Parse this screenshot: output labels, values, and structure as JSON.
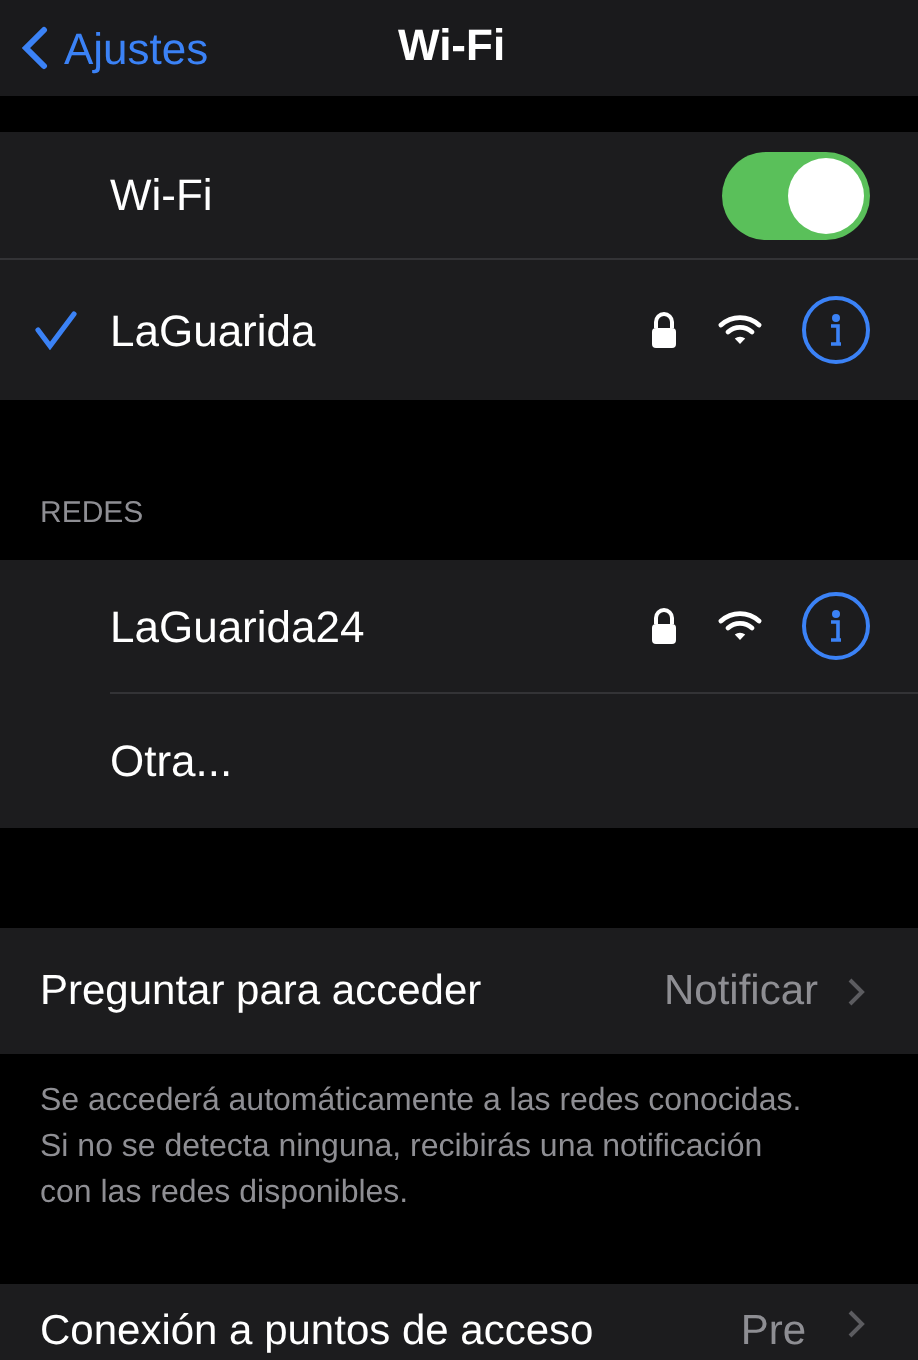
{
  "nav": {
    "back": "Ajustes",
    "title": "Wi-Fi"
  },
  "wifi": {
    "label": "Wi-Fi",
    "on": true,
    "current": {
      "name": "LaGuarida",
      "selected": true,
      "locked": true
    }
  },
  "networks": {
    "header": "REDES",
    "items": [
      {
        "kind": "network",
        "name": "LaGuarida24",
        "locked": true
      },
      {
        "kind": "other",
        "name": "Otra..."
      }
    ]
  },
  "ask": {
    "label": "Preguntar para acceder",
    "value": "Notificar",
    "footer": "Se accederá automáticamente a las redes conocidas. Si no se detecta ninguna, recibirás una notificación con las redes disponibles."
  },
  "hotspot": {
    "label": "Conexión a puntos de acceso",
    "value": "Pre"
  }
}
